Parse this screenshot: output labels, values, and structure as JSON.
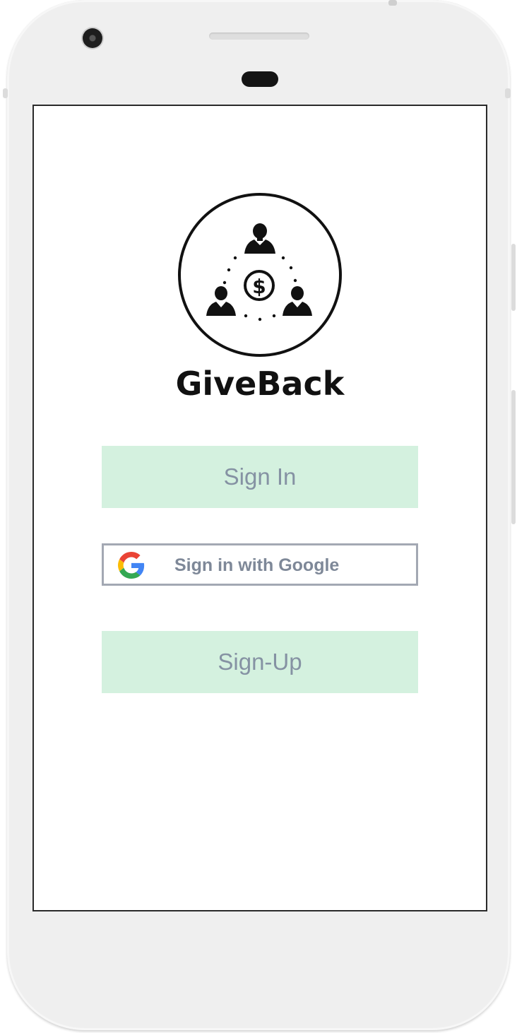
{
  "app": {
    "name": "GiveBack",
    "logo_icon": "people-money-circle-icon"
  },
  "buttons": {
    "sign_in": "Sign In",
    "google_sign_in": "Sign in with Google",
    "google_icon": "google-g-icon",
    "sign_up": "Sign-Up"
  },
  "colors": {
    "button_bg": "#d4f1df",
    "button_text": "#8592a3",
    "google_border": "#a3a8b3",
    "google_text": "#7e8898",
    "logo": "#111111"
  }
}
